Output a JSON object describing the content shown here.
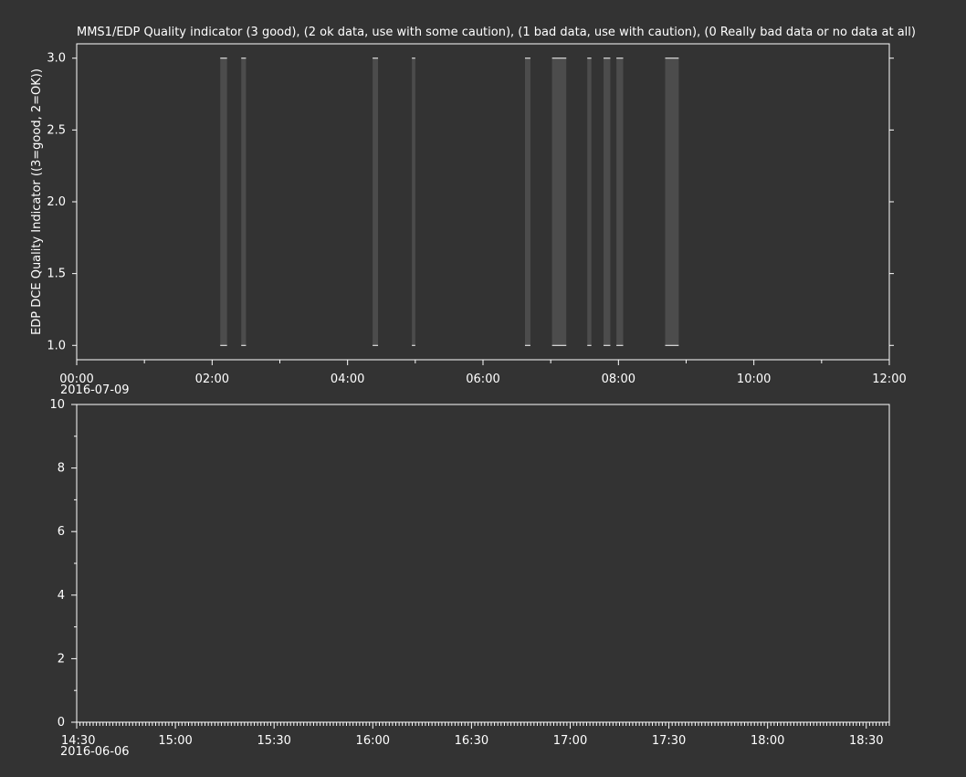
{
  "colors": {
    "background": "#333333",
    "axis": "#ffffff",
    "bar": "#4c4c4c",
    "tick_mark": "#ffffff"
  },
  "chart_data": [
    {
      "type": "bar",
      "title": "MMS1/EDP  Quality indicator (3 good), (2 ok data, use with some caution), (1 bad data, use with caution), (0 Really bad data or no data at all)",
      "ylabel": "EDP DCE Quality Indicator ((3=good, 2=OK))",
      "xlabel": "",
      "date_label": "2016-07-09",
      "x_unit": "hours since 00:00",
      "xlim": [
        0,
        12
      ],
      "ylim": [
        0.9,
        3.1
      ],
      "x_ticks": [
        {
          "value": 0,
          "label": "00:00"
        },
        {
          "value": 2,
          "label": "02:00"
        },
        {
          "value": 4,
          "label": "04:00"
        },
        {
          "value": 6,
          "label": "06:00"
        },
        {
          "value": 8,
          "label": "08:00"
        },
        {
          "value": 10,
          "label": "10:00"
        },
        {
          "value": 12,
          "label": "12:00"
        }
      ],
      "x_minor_ticks": [
        1,
        3,
        5,
        7,
        9,
        11
      ],
      "y_ticks": [
        {
          "value": 1.0,
          "label": "1.0"
        },
        {
          "value": 1.5,
          "label": "1.5"
        },
        {
          "value": 2.0,
          "label": "2.0"
        },
        {
          "value": 2.5,
          "label": "2.5"
        },
        {
          "value": 3.0,
          "label": "3.0"
        }
      ],
      "segments": [
        {
          "start": 2.12,
          "end": 2.22,
          "low": 1.0,
          "high": 3.0
        },
        {
          "start": 2.43,
          "end": 2.5,
          "low": 1.0,
          "high": 3.0
        },
        {
          "start": 4.37,
          "end": 4.45,
          "low": 1.0,
          "high": 3.0
        },
        {
          "start": 4.95,
          "end": 5.0,
          "low": 1.0,
          "high": 3.0
        },
        {
          "start": 6.62,
          "end": 6.7,
          "low": 1.0,
          "high": 3.0
        },
        {
          "start": 7.02,
          "end": 7.23,
          "low": 1.0,
          "high": 3.0
        },
        {
          "start": 7.54,
          "end": 7.6,
          "low": 1.0,
          "high": 3.0
        },
        {
          "start": 7.78,
          "end": 7.88,
          "low": 1.0,
          "high": 3.0
        },
        {
          "start": 7.97,
          "end": 8.07,
          "low": 1.0,
          "high": 3.0
        },
        {
          "start": 8.69,
          "end": 8.89,
          "low": 1.0,
          "high": 3.0
        }
      ],
      "grid": false
    },
    {
      "type": "line",
      "title": "",
      "ylabel": "",
      "xlabel": "",
      "date_label": "2016-06-06",
      "x_unit": "minutes since 14:30",
      "xlim": [
        0,
        247
      ],
      "ylim": [
        0,
        10
      ],
      "x_ticks": [
        {
          "value": 0,
          "label": "14:30"
        },
        {
          "value": 30,
          "label": "15:00"
        },
        {
          "value": 60,
          "label": "15:30"
        },
        {
          "value": 90,
          "label": "16:00"
        },
        {
          "value": 120,
          "label": "16:30"
        },
        {
          "value": 150,
          "label": "17:00"
        },
        {
          "value": 180,
          "label": "17:30"
        },
        {
          "value": 210,
          "label": "18:00"
        },
        {
          "value": 240,
          "label": "18:30"
        }
      ],
      "x_minor_step": 1,
      "y_ticks": [
        {
          "value": 0,
          "label": "0"
        },
        {
          "value": 2,
          "label": "2"
        },
        {
          "value": 4,
          "label": "4"
        },
        {
          "value": 6,
          "label": "6"
        },
        {
          "value": 8,
          "label": "8"
        },
        {
          "value": 10,
          "label": "10"
        }
      ],
      "y_minor_ticks": [
        1,
        3,
        5,
        7,
        9
      ],
      "series": [],
      "grid": false
    }
  ]
}
